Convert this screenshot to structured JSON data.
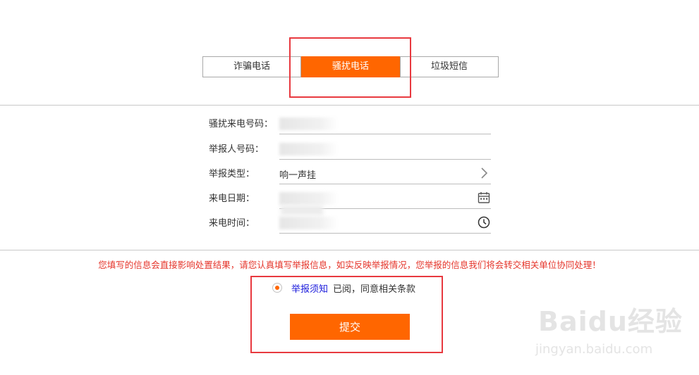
{
  "tabs": [
    {
      "label": "诈骗电话",
      "active": false
    },
    {
      "label": "骚扰电话",
      "active": true
    },
    {
      "label": "垃圾短信",
      "active": false
    }
  ],
  "form": {
    "caller_number": {
      "label": "骚扰来电号码："
    },
    "reporter_number": {
      "label": "举报人号码："
    },
    "report_type": {
      "label": "举报类型：",
      "value": "响一声挂"
    },
    "call_date": {
      "label": "来电日期："
    },
    "call_time": {
      "label": "来电时间："
    }
  },
  "warning": "您填写的信息会直接影响处置结果，请您认真填写举报信息，如实反映举报情况，您举报的信息我们将会转交相关单位协同处理！",
  "agreement": {
    "link": "举报须知",
    "text": "已阅，同意相关条款",
    "checked": true
  },
  "submit_label": "提交",
  "watermark": {
    "logo": "Baidu经验",
    "url": "jingyan.baidu.com"
  },
  "colors": {
    "accent": "#ff6600",
    "highlight": "#e8393f",
    "warning": "#e5352b",
    "link": "#1a1adb"
  }
}
